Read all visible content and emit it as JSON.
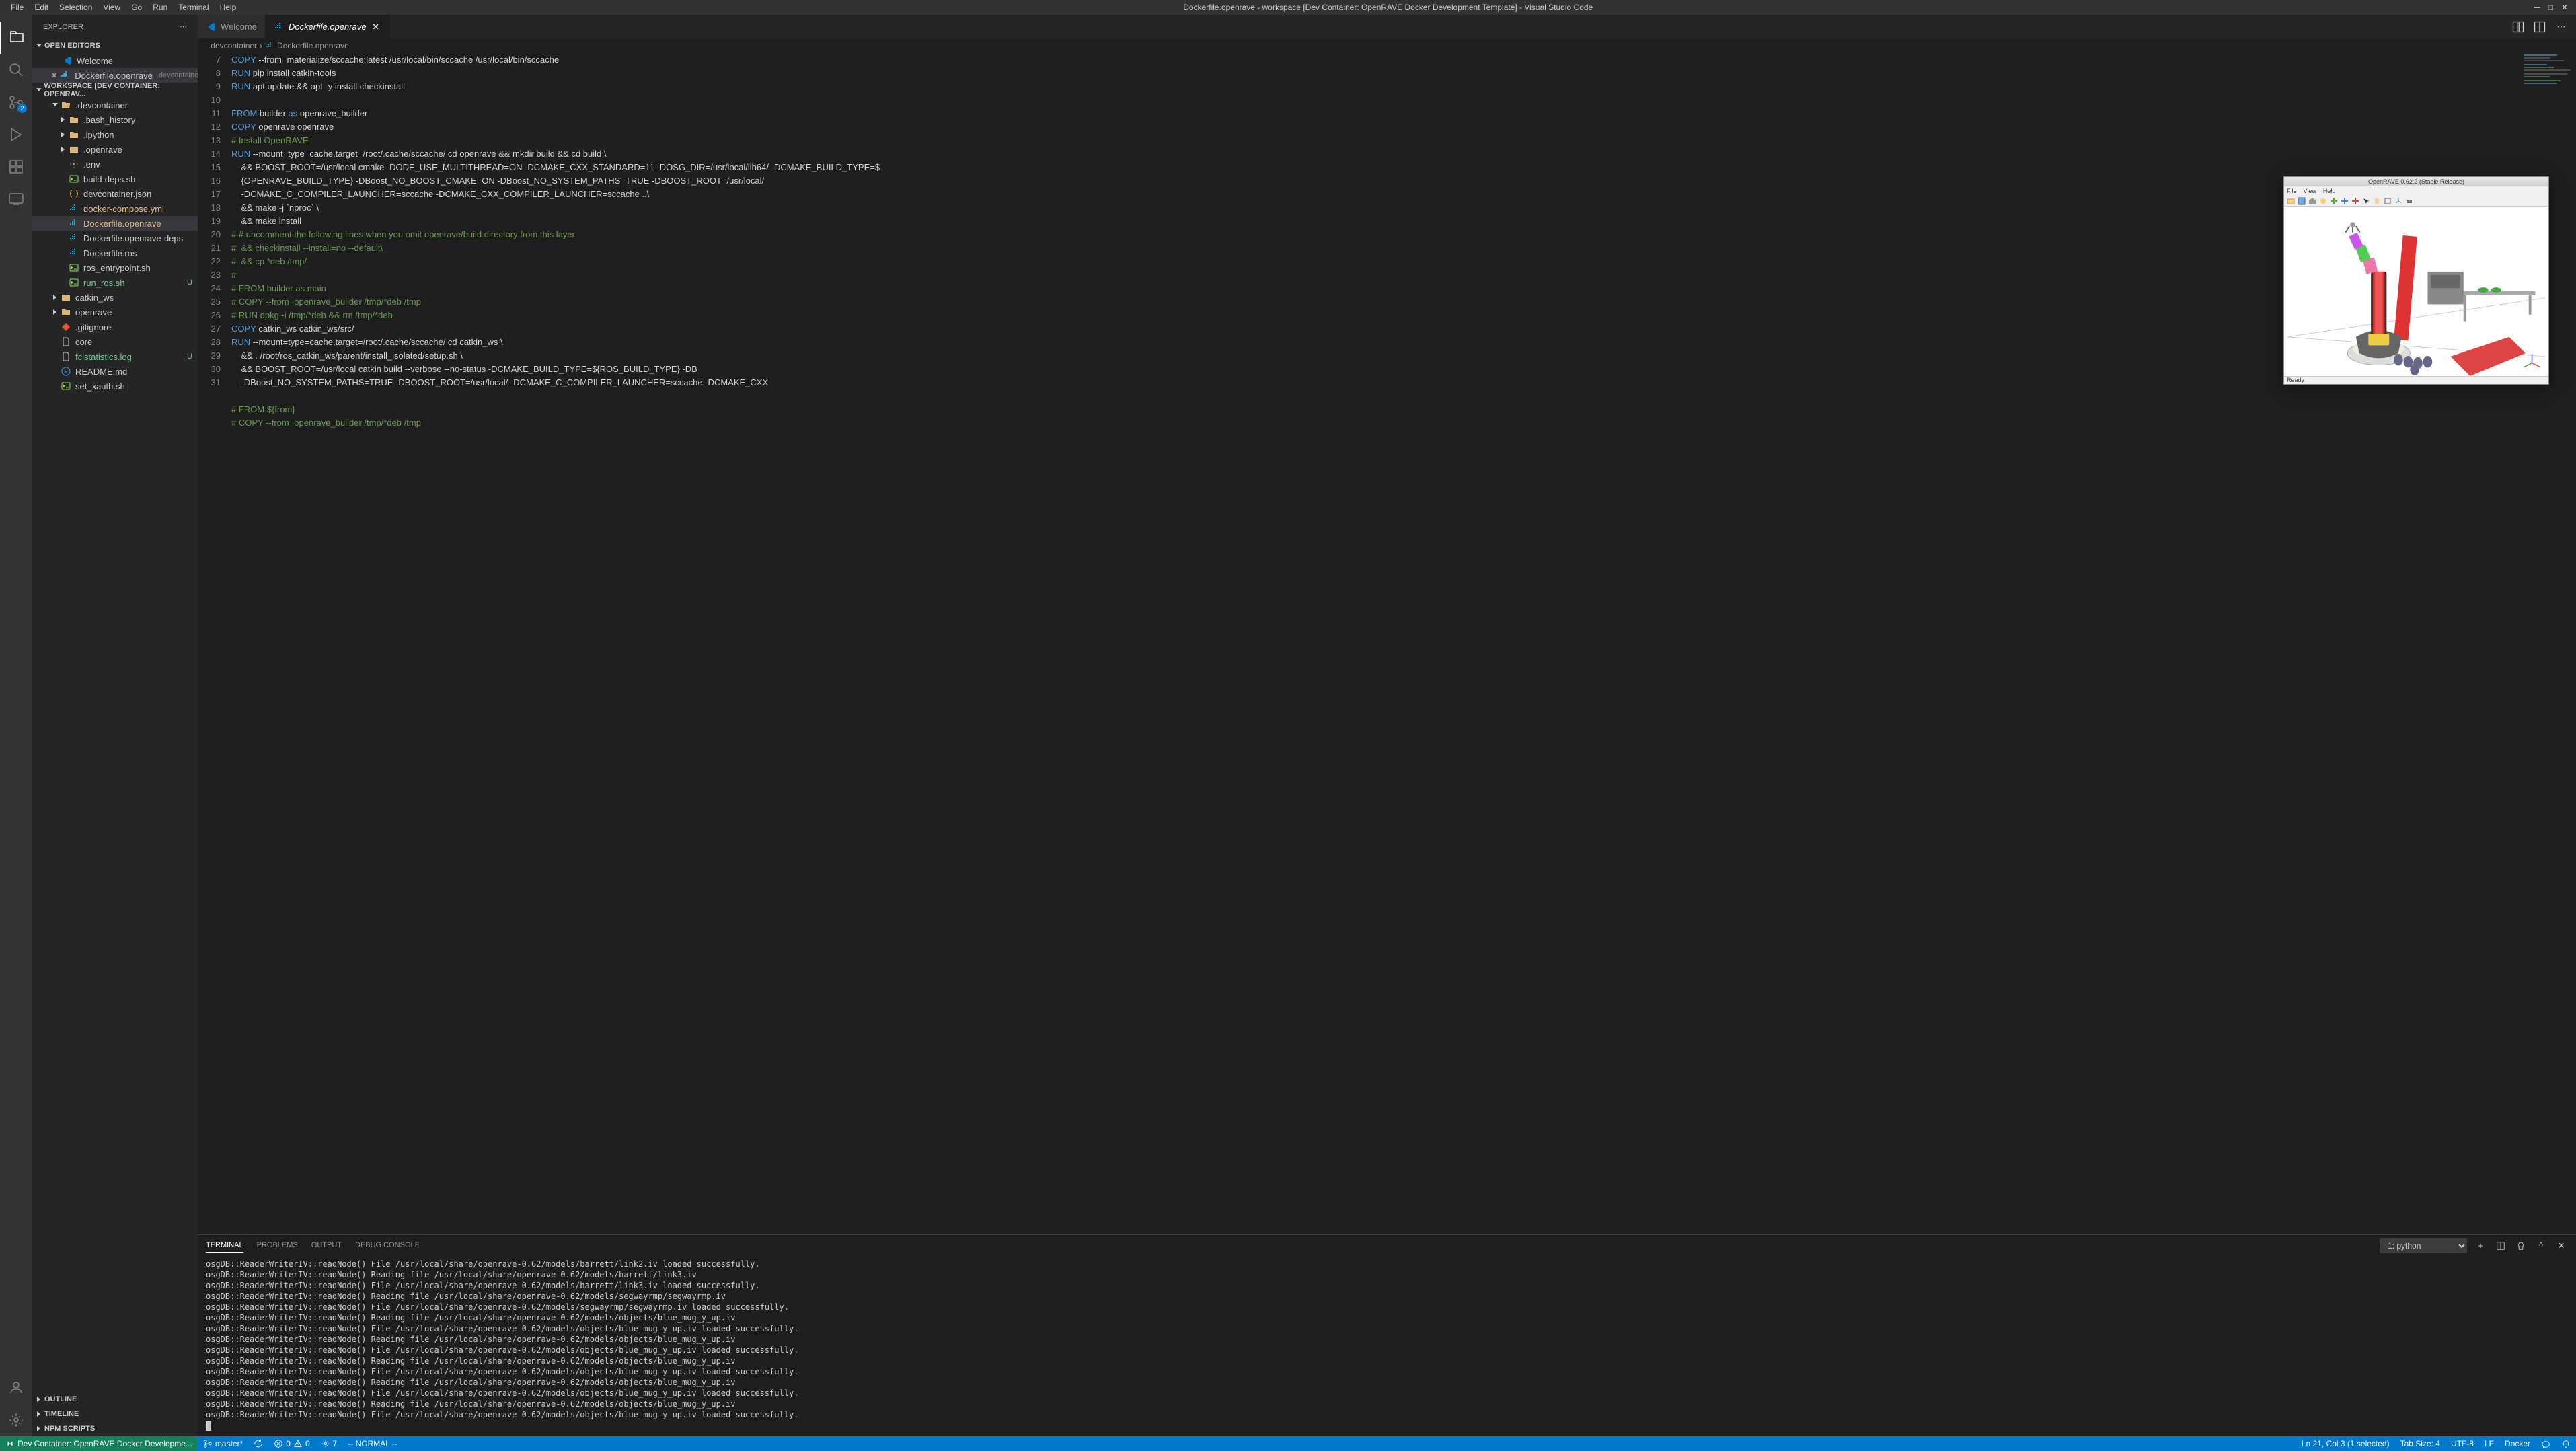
{
  "window": {
    "title": "Dockerfile.openrave - workspace [Dev Container: OpenRAVE Docker Development Template] - Visual Studio Code"
  },
  "menubar": {
    "items": [
      "File",
      "Edit",
      "Selection",
      "View",
      "Go",
      "Run",
      "Terminal",
      "Help"
    ]
  },
  "sidebar": {
    "title": "EXPLORER",
    "open_editors_label": "OPEN EDITORS",
    "workspace_label": "WORKSPACE [DEV CONTAINER: OPENRAV...",
    "outline_label": "OUTLINE",
    "timeline_label": "TIMELINE",
    "npm_label": "NPM SCRIPTS",
    "open_editors": [
      {
        "name": "Welcome",
        "icon": "vscode"
      },
      {
        "name": "Dockerfile.openrave",
        "path": ".devcontainer",
        "icon": "docker",
        "active": true
      }
    ],
    "tree": [
      {
        "name": ".devcontainer",
        "type": "folder",
        "expanded": true,
        "indent": 0,
        "status": ""
      },
      {
        "name": ".bash_history",
        "type": "folder",
        "expanded": false,
        "indent": 1,
        "status": ""
      },
      {
        "name": ".ipython",
        "type": "folder",
        "expanded": false,
        "indent": 1,
        "status": ""
      },
      {
        "name": ".openrave",
        "type": "folder",
        "expanded": false,
        "indent": 1,
        "status": ""
      },
      {
        "name": ".env",
        "type": "file",
        "indent": 1,
        "icon": "gear",
        "status": ""
      },
      {
        "name": "build-deps.sh",
        "type": "file",
        "indent": 1,
        "icon": "shell",
        "status": ""
      },
      {
        "name": "devcontainer.json",
        "type": "file",
        "indent": 1,
        "icon": "json",
        "status": ""
      },
      {
        "name": "docker-compose.yml",
        "type": "file",
        "indent": 1,
        "icon": "docker",
        "status": "",
        "modified": true
      },
      {
        "name": "Dockerfile.openrave",
        "type": "file",
        "indent": 1,
        "icon": "docker",
        "status": "",
        "selected": true,
        "modified": true
      },
      {
        "name": "Dockerfile.openrave-deps",
        "type": "file",
        "indent": 1,
        "icon": "docker",
        "status": ""
      },
      {
        "name": "Dockerfile.ros",
        "type": "file",
        "indent": 1,
        "icon": "docker",
        "status": ""
      },
      {
        "name": "ros_entrypoint.sh",
        "type": "file",
        "indent": 1,
        "icon": "shell",
        "status": ""
      },
      {
        "name": "run_ros.sh",
        "type": "file",
        "indent": 1,
        "icon": "shell",
        "status": "U",
        "untracked": true
      },
      {
        "name": "catkin_ws",
        "type": "folder",
        "expanded": false,
        "indent": 0,
        "status": ""
      },
      {
        "name": "openrave",
        "type": "folder",
        "expanded": false,
        "indent": 0,
        "status": ""
      },
      {
        "name": ".gitignore",
        "type": "file",
        "indent": 0,
        "icon": "git",
        "status": ""
      },
      {
        "name": "core",
        "type": "file",
        "indent": 0,
        "icon": "file",
        "status": ""
      },
      {
        "name": "fclstatistics.log",
        "type": "file",
        "indent": 0,
        "icon": "file",
        "status": "U",
        "untracked": true
      },
      {
        "name": "README.md",
        "type": "file",
        "indent": 0,
        "icon": "info",
        "status": ""
      },
      {
        "name": "set_xauth.sh",
        "type": "file",
        "indent": 0,
        "icon": "shell",
        "status": ""
      }
    ]
  },
  "tabs": [
    {
      "name": "Welcome",
      "icon": "vscode",
      "active": false
    },
    {
      "name": "Dockerfile.openrave",
      "icon": "docker",
      "active": true
    }
  ],
  "breadcrumb": {
    "parts": [
      ".devcontainer",
      "Dockerfile.openrave"
    ]
  },
  "code_lines": [
    {
      "num": 7,
      "html": "<span class='kw-copy'>COPY</span> --from=materialize/sccache:latest /usr/local/bin/sccache /usr/local/bin/sccache"
    },
    {
      "num": 8,
      "html": "<span class='kw-run'>RUN</span> pip install catkin-tools"
    },
    {
      "num": 9,
      "html": "<span class='kw-run'>RUN</span> apt update && apt -y install checkinstall"
    },
    {
      "num": 10,
      "html": ""
    },
    {
      "num": 11,
      "html": "<span class='kw-from'>FROM</span> builder <span class='kw-as'>as</span> openrave_builder"
    },
    {
      "num": 12,
      "html": "<span class='kw-copy'>COPY</span> openrave openrave"
    },
    {
      "num": 13,
      "html": "<span class='comment'># Install OpenRAVE</span>"
    },
    {
      "num": 14,
      "html": "<span class='kw-run'>RUN</span> --mount=type=cache,target=/root/.cache/sccache/ cd openrave && mkdir build && cd build \\"
    },
    {
      "num": 15,
      "html": "    && BOOST_ROOT=/usr/local cmake -DODE_USE_MULTITHREAD=ON -DCMAKE_CXX_STANDARD=11 -DOSG_DIR=/usr/local/lib64/ -DCMAKE_BUILD_TYPE=$\n    {OPENRAVE_BUILD_TYPE} -DBoost_NO_BOOST_CMAKE=ON -DBoost_NO_SYSTEM_PATHS=TRUE -DBOOST_ROOT=/usr/local/\n    -DCMAKE_C_COMPILER_LAUNCHER=sccache -DCMAKE_CXX_COMPILER_LAUNCHER=sccache ..\\"
    },
    {
      "num": 16,
      "html": "    && make -j `nproc` \\"
    },
    {
      "num": 17,
      "html": "    && make install"
    },
    {
      "num": 18,
      "html": "<span class='comment'># # uncomment the following lines when you omit openrave/build directory from this layer</span>"
    },
    {
      "num": 19,
      "html": "<span class='comment'>#  && checkinstall --install=no --default\\</span>"
    },
    {
      "num": 20,
      "html": "<span class='comment'>#  && cp *deb /tmp/</span>"
    },
    {
      "num": 21,
      "html": "<span class='comment'>#</span>"
    },
    {
      "num": 22,
      "html": "<span class='comment'># FROM builder as main</span>"
    },
    {
      "num": 23,
      "html": "<span class='comment'># COPY --from=openrave_builder /tmp/*deb /tmp</span>"
    },
    {
      "num": 24,
      "html": "<span class='comment'># RUN dpkg -i /tmp/*deb && rm /tmp/*deb</span>"
    },
    {
      "num": 25,
      "html": "<span class='kw-copy'>COPY</span> catkin_ws catkin_ws/src/"
    },
    {
      "num": 26,
      "html": "<span class='kw-run'>RUN</span> --mount=type=cache,target=/root/.cache/sccache/ cd catkin_ws \\"
    },
    {
      "num": 27,
      "html": "    && . /root/ros_catkin_ws/parent/install_isolated/setup.sh \\"
    },
    {
      "num": 28,
      "html": "    && BOOST_ROOT=/usr/local catkin build --verbose --no-status -DCMAKE_BUILD_TYPE=${ROS_BUILD_TYPE} -DB\n    -DBoost_NO_SYSTEM_PATHS=TRUE -DBOOST_ROOT=/usr/local/ -DCMAKE_C_COMPILER_LAUNCHER=sccache -DCMAKE_CXX"
    },
    {
      "num": 29,
      "html": ""
    },
    {
      "num": 30,
      "html": "<span class='comment'># FROM ${from}</span>"
    },
    {
      "num": 31,
      "html": "<span class='comment'># COPY --from=openrave_builder /tmp/*deb /tmp</span>"
    }
  ],
  "panel": {
    "tabs": [
      "TERMINAL",
      "PROBLEMS",
      "OUTPUT",
      "DEBUG CONSOLE"
    ],
    "active_tab": "TERMINAL",
    "shell_label": "1: python",
    "terminal_lines": [
      "osgDB::ReaderWriterIV::readNode() File /usr/local/share/openrave-0.62/models/barrett/link2.iv loaded successfully.",
      "osgDB::ReaderWriterIV::readNode() Reading file /usr/local/share/openrave-0.62/models/barrett/link3.iv",
      "osgDB::ReaderWriterIV::readNode() File /usr/local/share/openrave-0.62/models/barrett/link3.iv loaded successfully.",
      "osgDB::ReaderWriterIV::readNode() Reading file /usr/local/share/openrave-0.62/models/segwayrmp/segwayrmp.iv",
      "osgDB::ReaderWriterIV::readNode() File /usr/local/share/openrave-0.62/models/segwayrmp/segwayrmp.iv loaded successfully.",
      "osgDB::ReaderWriterIV::readNode() Reading file /usr/local/share/openrave-0.62/models/objects/blue_mug_y_up.iv",
      "osgDB::ReaderWriterIV::readNode() File /usr/local/share/openrave-0.62/models/objects/blue_mug_y_up.iv loaded successfully.",
      "osgDB::ReaderWriterIV::readNode() Reading file /usr/local/share/openrave-0.62/models/objects/blue_mug_y_up.iv",
      "osgDB::ReaderWriterIV::readNode() File /usr/local/share/openrave-0.62/models/objects/blue_mug_y_up.iv loaded successfully.",
      "osgDB::ReaderWriterIV::readNode() Reading file /usr/local/share/openrave-0.62/models/objects/blue_mug_y_up.iv",
      "osgDB::ReaderWriterIV::readNode() File /usr/local/share/openrave-0.62/models/objects/blue_mug_y_up.iv loaded successfully.",
      "osgDB::ReaderWriterIV::readNode() Reading file /usr/local/share/openrave-0.62/models/objects/blue_mug_y_up.iv",
      "osgDB::ReaderWriterIV::readNode() File /usr/local/share/openrave-0.62/models/objects/blue_mug_y_up.iv loaded successfully.",
      "osgDB::ReaderWriterIV::readNode() Reading file /usr/local/share/openrave-0.62/models/objects/blue_mug_y_up.iv",
      "osgDB::ReaderWriterIV::readNode() File /usr/local/share/openrave-0.62/models/objects/blue_mug_y_up.iv loaded successfully."
    ]
  },
  "floating": {
    "title": "OpenRAVE 0.62.2 (Stable Release)",
    "menus": [
      "File",
      "View",
      "Help"
    ],
    "status": "Ready"
  },
  "statusbar": {
    "remote": "Dev Container: OpenRAVE Docker Developme...",
    "branch": "master*",
    "sync": "",
    "errors": "0",
    "warnings": "0",
    "ports": "7",
    "mode": "-- NORMAL --",
    "position": "Ln 21, Col 3 (1 selected)",
    "tabsize": "Tab Size: 4",
    "encoding": "UTF-8",
    "eol": "LF",
    "language": "Docker"
  },
  "scm_badge": "2"
}
